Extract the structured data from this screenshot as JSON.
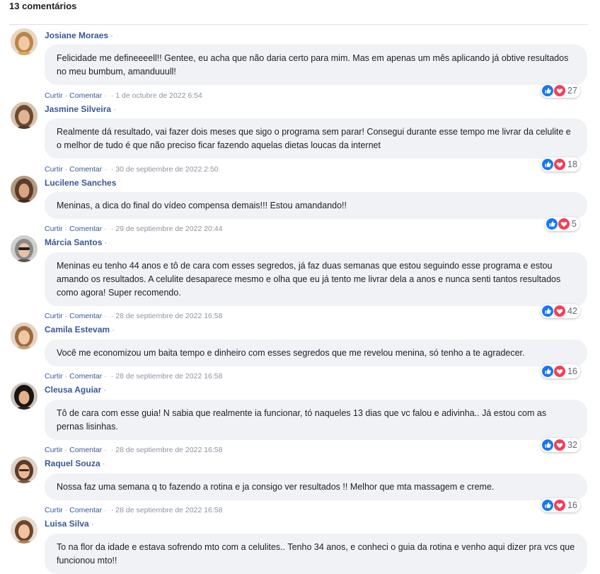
{
  "header": {
    "title": "13 comentários"
  },
  "actions": {
    "like_label": "Curtir",
    "reply_label": "Comentar",
    "separator": "·"
  },
  "colors": {
    "like_blue": "#1877f2",
    "love_red": "#f33e58",
    "name_blue": "#385898",
    "bubble_bg": "#f0f2f5"
  },
  "comments": [
    {
      "name": "Josiane Moraes",
      "text": "Felicidade me defineeeell!! Gentee, eu acha que não daria certo para mim. Mas em apenas um mês aplicando já obtive resultados no meu bumbum, amanduuull!",
      "date": "1 de octubre de 2022 6:54",
      "reactions": "27"
    },
    {
      "name": "Jasmine Silveira",
      "text": "Realmente dá resultado, vai fazer dois meses que sigo o programa sem parar! Consegui durante esse tempo me livrar da celulite e o melhor de tudo é que não preciso ficar fazendo aquelas dietas loucas da internet",
      "date": "30 de septiembre de 2022 2:50",
      "reactions": "18"
    },
    {
      "name": "Lucilene Sanches",
      "text": "Meninas, a dica do final do vídeo compensa demais!!! Estou amandando!!",
      "date": "29 de septiembre de 2022 20:44",
      "reactions": "5"
    },
    {
      "name": "Márcia Santos",
      "text": "Meninas eu tenho 44 anos e tô de cara com esses segredos, já faz duas semanas que estou seguindo esse programa e estou amando os resultados. A celulite desaparece mesmo e olha que eu já tento me livrar dela a anos e nunca senti tantos resultados como agora! Super recomendo.",
      "date": "28 de septiembre de 2022 16:58",
      "reactions": "42"
    },
    {
      "name": "Camila Estevam",
      "text": "Você me economizou um baita tempo e dinheiro com esses segredos que me revelou menina, só tenho a te agradecer.",
      "date": "28 de septiembre de 2022 16:58",
      "reactions": "16"
    },
    {
      "name": "Cleusa Aguiar",
      "text": "Tô de cara com esse guia! N sabia que realmente ia funcionar, tó naqueles 13 dias que vc falou e adivinha.. Já estou com as pernas lisinhas.",
      "date": "28 de septiembre de 2022 16:58",
      "reactions": "32"
    },
    {
      "name": "Raquel Souza",
      "text": "Nossa faz uma semana q to fazendo a rotina e ja consigo ver resultados !! Melhor que mta massagem e creme.",
      "date": "28 de septiembre de 2022 16:58",
      "reactions": "16"
    },
    {
      "name": "Luisa Silva",
      "text": "To na flor da idade e estava sofrendo mto com a celulites.. Tenho 34 anos, e conheci o guia da rotina e venho aqui dizer pra vcs que funcionou mto!!",
      "date": "",
      "reactions": ""
    }
  ]
}
